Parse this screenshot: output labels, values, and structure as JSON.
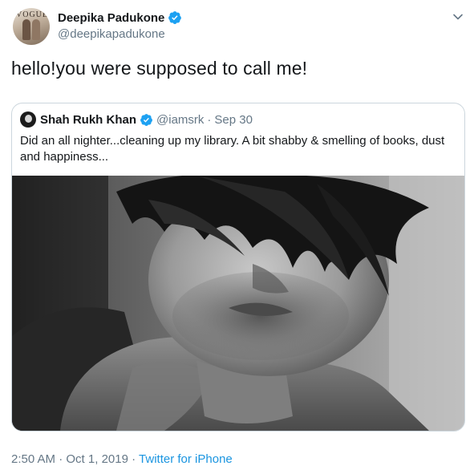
{
  "tweet": {
    "author": {
      "name": "Deepika Padukone",
      "handle": "@deepikapadukone",
      "avatar_text": "VOGUE",
      "verified": true
    },
    "text": "hello!you were supposed to call me!",
    "quoted": {
      "author": {
        "name": "Shah Rukh Khan",
        "handle": "@iamsrk",
        "verified": true
      },
      "separator": "·",
      "date": "Sep 30",
      "text": "Did an all nighter...cleaning up my library. A bit shabby & smelling of books, dust and happiness...",
      "media": {
        "type": "photo",
        "style": "black-and-white portrait"
      }
    },
    "footer": {
      "time": "2:50 AM",
      "separator1": "·",
      "date": "Oct 1, 2019",
      "separator2": "·",
      "source": "Twitter for iPhone"
    }
  },
  "icons": {
    "verified": "verified-badge-icon",
    "menu": "chevron-down-icon"
  },
  "colors": {
    "accent": "#1da1f2",
    "link": "#1b95e0",
    "secondary_text": "#657786",
    "border": "#ccd6dd"
  }
}
